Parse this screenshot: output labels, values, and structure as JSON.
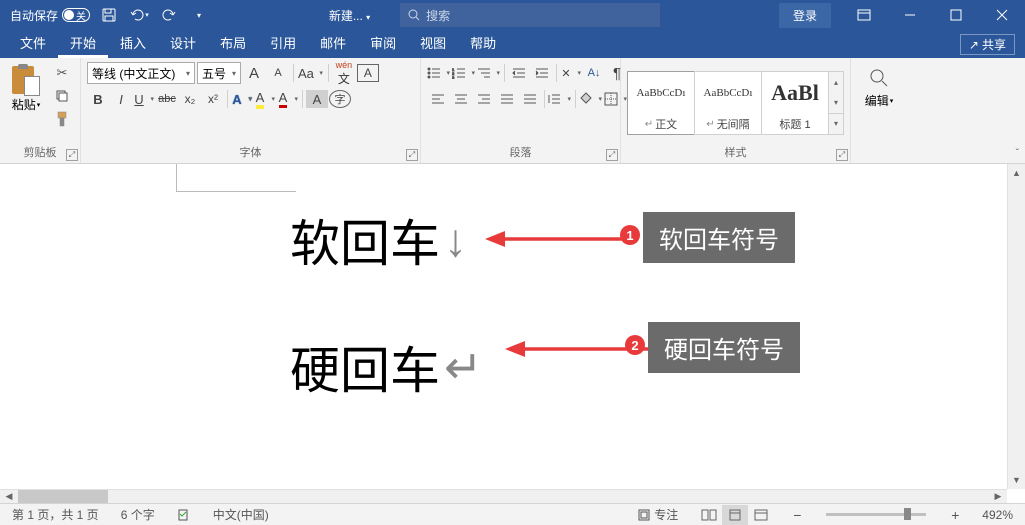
{
  "titlebar": {
    "autosave_label": "自动保存",
    "autosave_state": "关",
    "doc_title": "新建...",
    "search_placeholder": "搜索",
    "login": "登录"
  },
  "tabs": {
    "file": "文件",
    "home": "开始",
    "insert": "插入",
    "design": "设计",
    "layout": "布局",
    "references": "引用",
    "mail": "邮件",
    "review": "审阅",
    "view": "视图",
    "help": "帮助",
    "share": "共享"
  },
  "ribbon": {
    "clipboard": {
      "paste": "粘贴",
      "label": "剪贴板"
    },
    "font": {
      "name": "等线 (中文正文)",
      "size": "五号",
      "bigA": "A",
      "smallA": "A",
      "clearFmt": "Aa",
      "phonetic": "wén",
      "charBorder": "A",
      "bold": "B",
      "italic": "I",
      "underline": "U",
      "strike": "abc",
      "sub": "x₂",
      "sup": "x²",
      "effect": "A",
      "highlight": "A",
      "fontcolor": "A",
      "charshade": "A",
      "enclosed": "字",
      "label": "字体"
    },
    "para": {
      "label": "段落"
    },
    "styles": {
      "s1_preview": "AaBbCcDı",
      "s1_name": "正文",
      "s2_preview": "AaBbCcDı",
      "s2_name": "无间隔",
      "s3_preview": "AaBl",
      "s3_name": "标题 1",
      "note": "↵",
      "label": "样式"
    },
    "editing": {
      "find": "编辑",
      "label": ""
    }
  },
  "document": {
    "line1": "软回车",
    "line2": "硬回车"
  },
  "annotations": {
    "callout1": "软回车符号",
    "callout2": "硬回车符号",
    "num1": "1",
    "num2": "2"
  },
  "status": {
    "page": "第 1 页，共 1 页",
    "words": "6 个字",
    "lang": "中文(中国)",
    "focus": "专注",
    "zoom": "492%"
  }
}
